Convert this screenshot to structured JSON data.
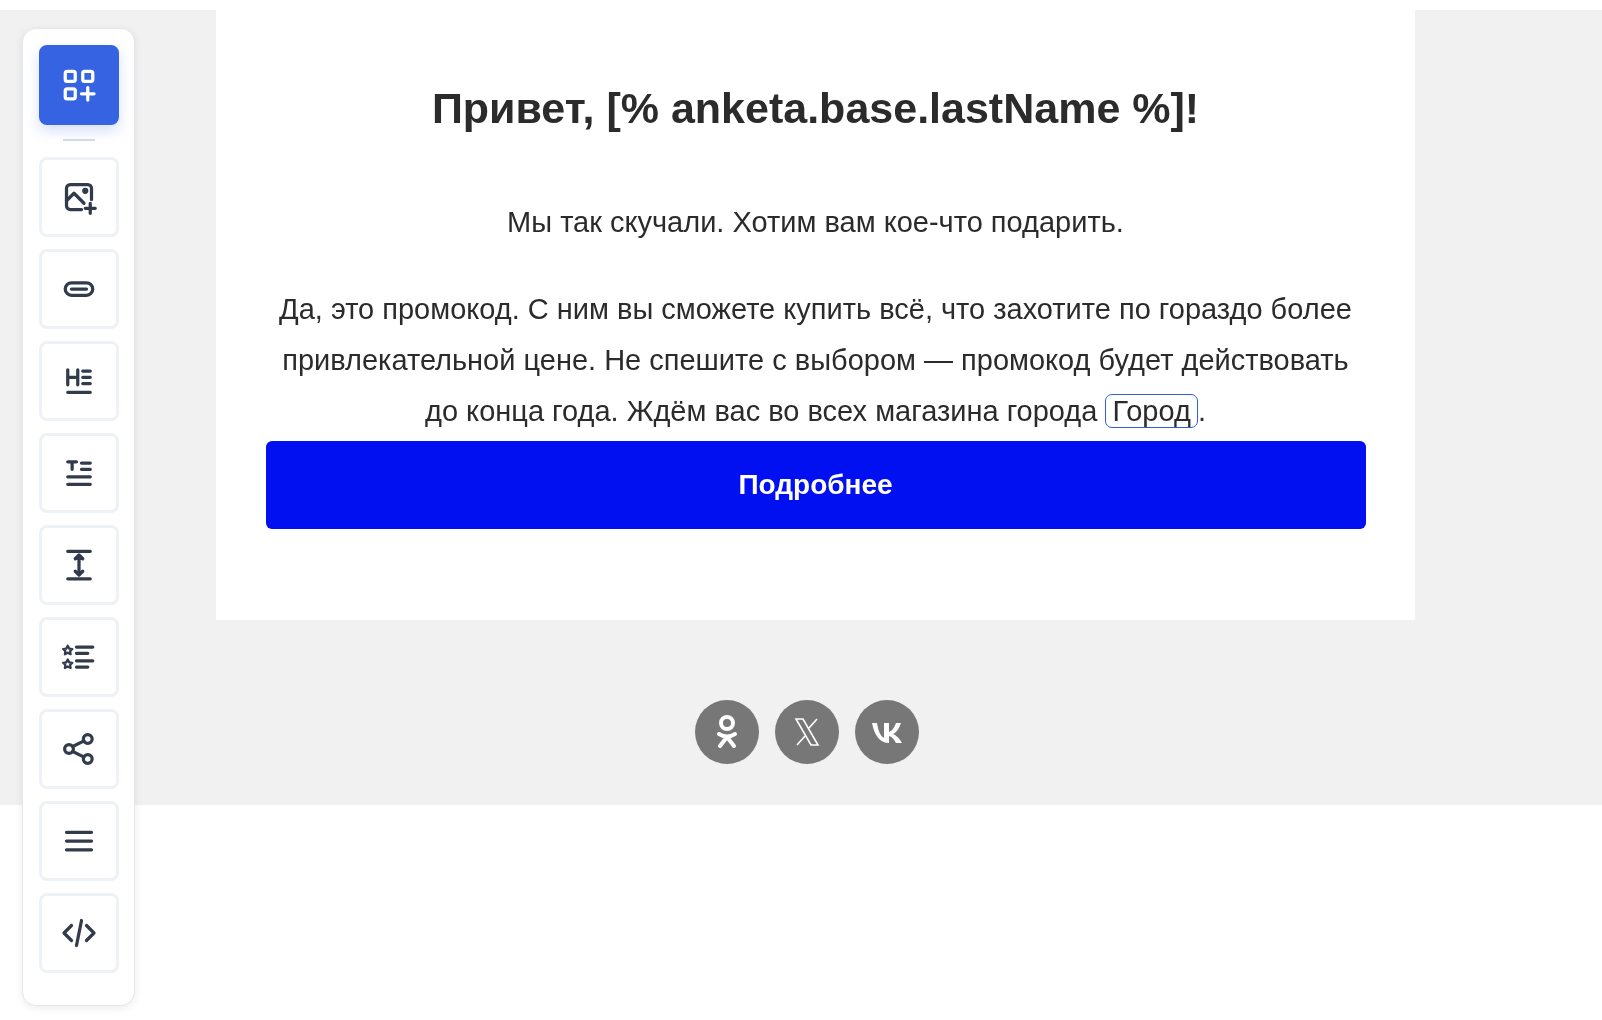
{
  "sidebar": {
    "items": [
      {
        "kind": "add-block",
        "selected": true
      },
      {
        "kind": "image",
        "selected": false
      },
      {
        "kind": "button",
        "selected": false
      },
      {
        "kind": "heading",
        "selected": false
      },
      {
        "kind": "text",
        "selected": false
      },
      {
        "kind": "spacer",
        "selected": false
      },
      {
        "kind": "list",
        "selected": false
      },
      {
        "kind": "share",
        "selected": false
      },
      {
        "kind": "menu",
        "selected": false
      },
      {
        "kind": "code",
        "selected": false
      }
    ]
  },
  "email": {
    "heading": "Привет, [% anketa.base.lastName %]!",
    "intro": "Мы так скучали. Хотим вам кое-что подарить.",
    "body": {
      "text": "Да, это промокод. С ним вы сможете купить всё, что захотите по гораздо более привлекательной цене. Не спешите с выбором — промокод будет действовать до конца года. Ждём вас во всех магазина города",
      "variable": "Город",
      "after": "."
    },
    "button": "Подробнее"
  },
  "social": [
    {
      "kind": "ok"
    },
    {
      "kind": "x"
    },
    {
      "kind": "vk"
    }
  ]
}
